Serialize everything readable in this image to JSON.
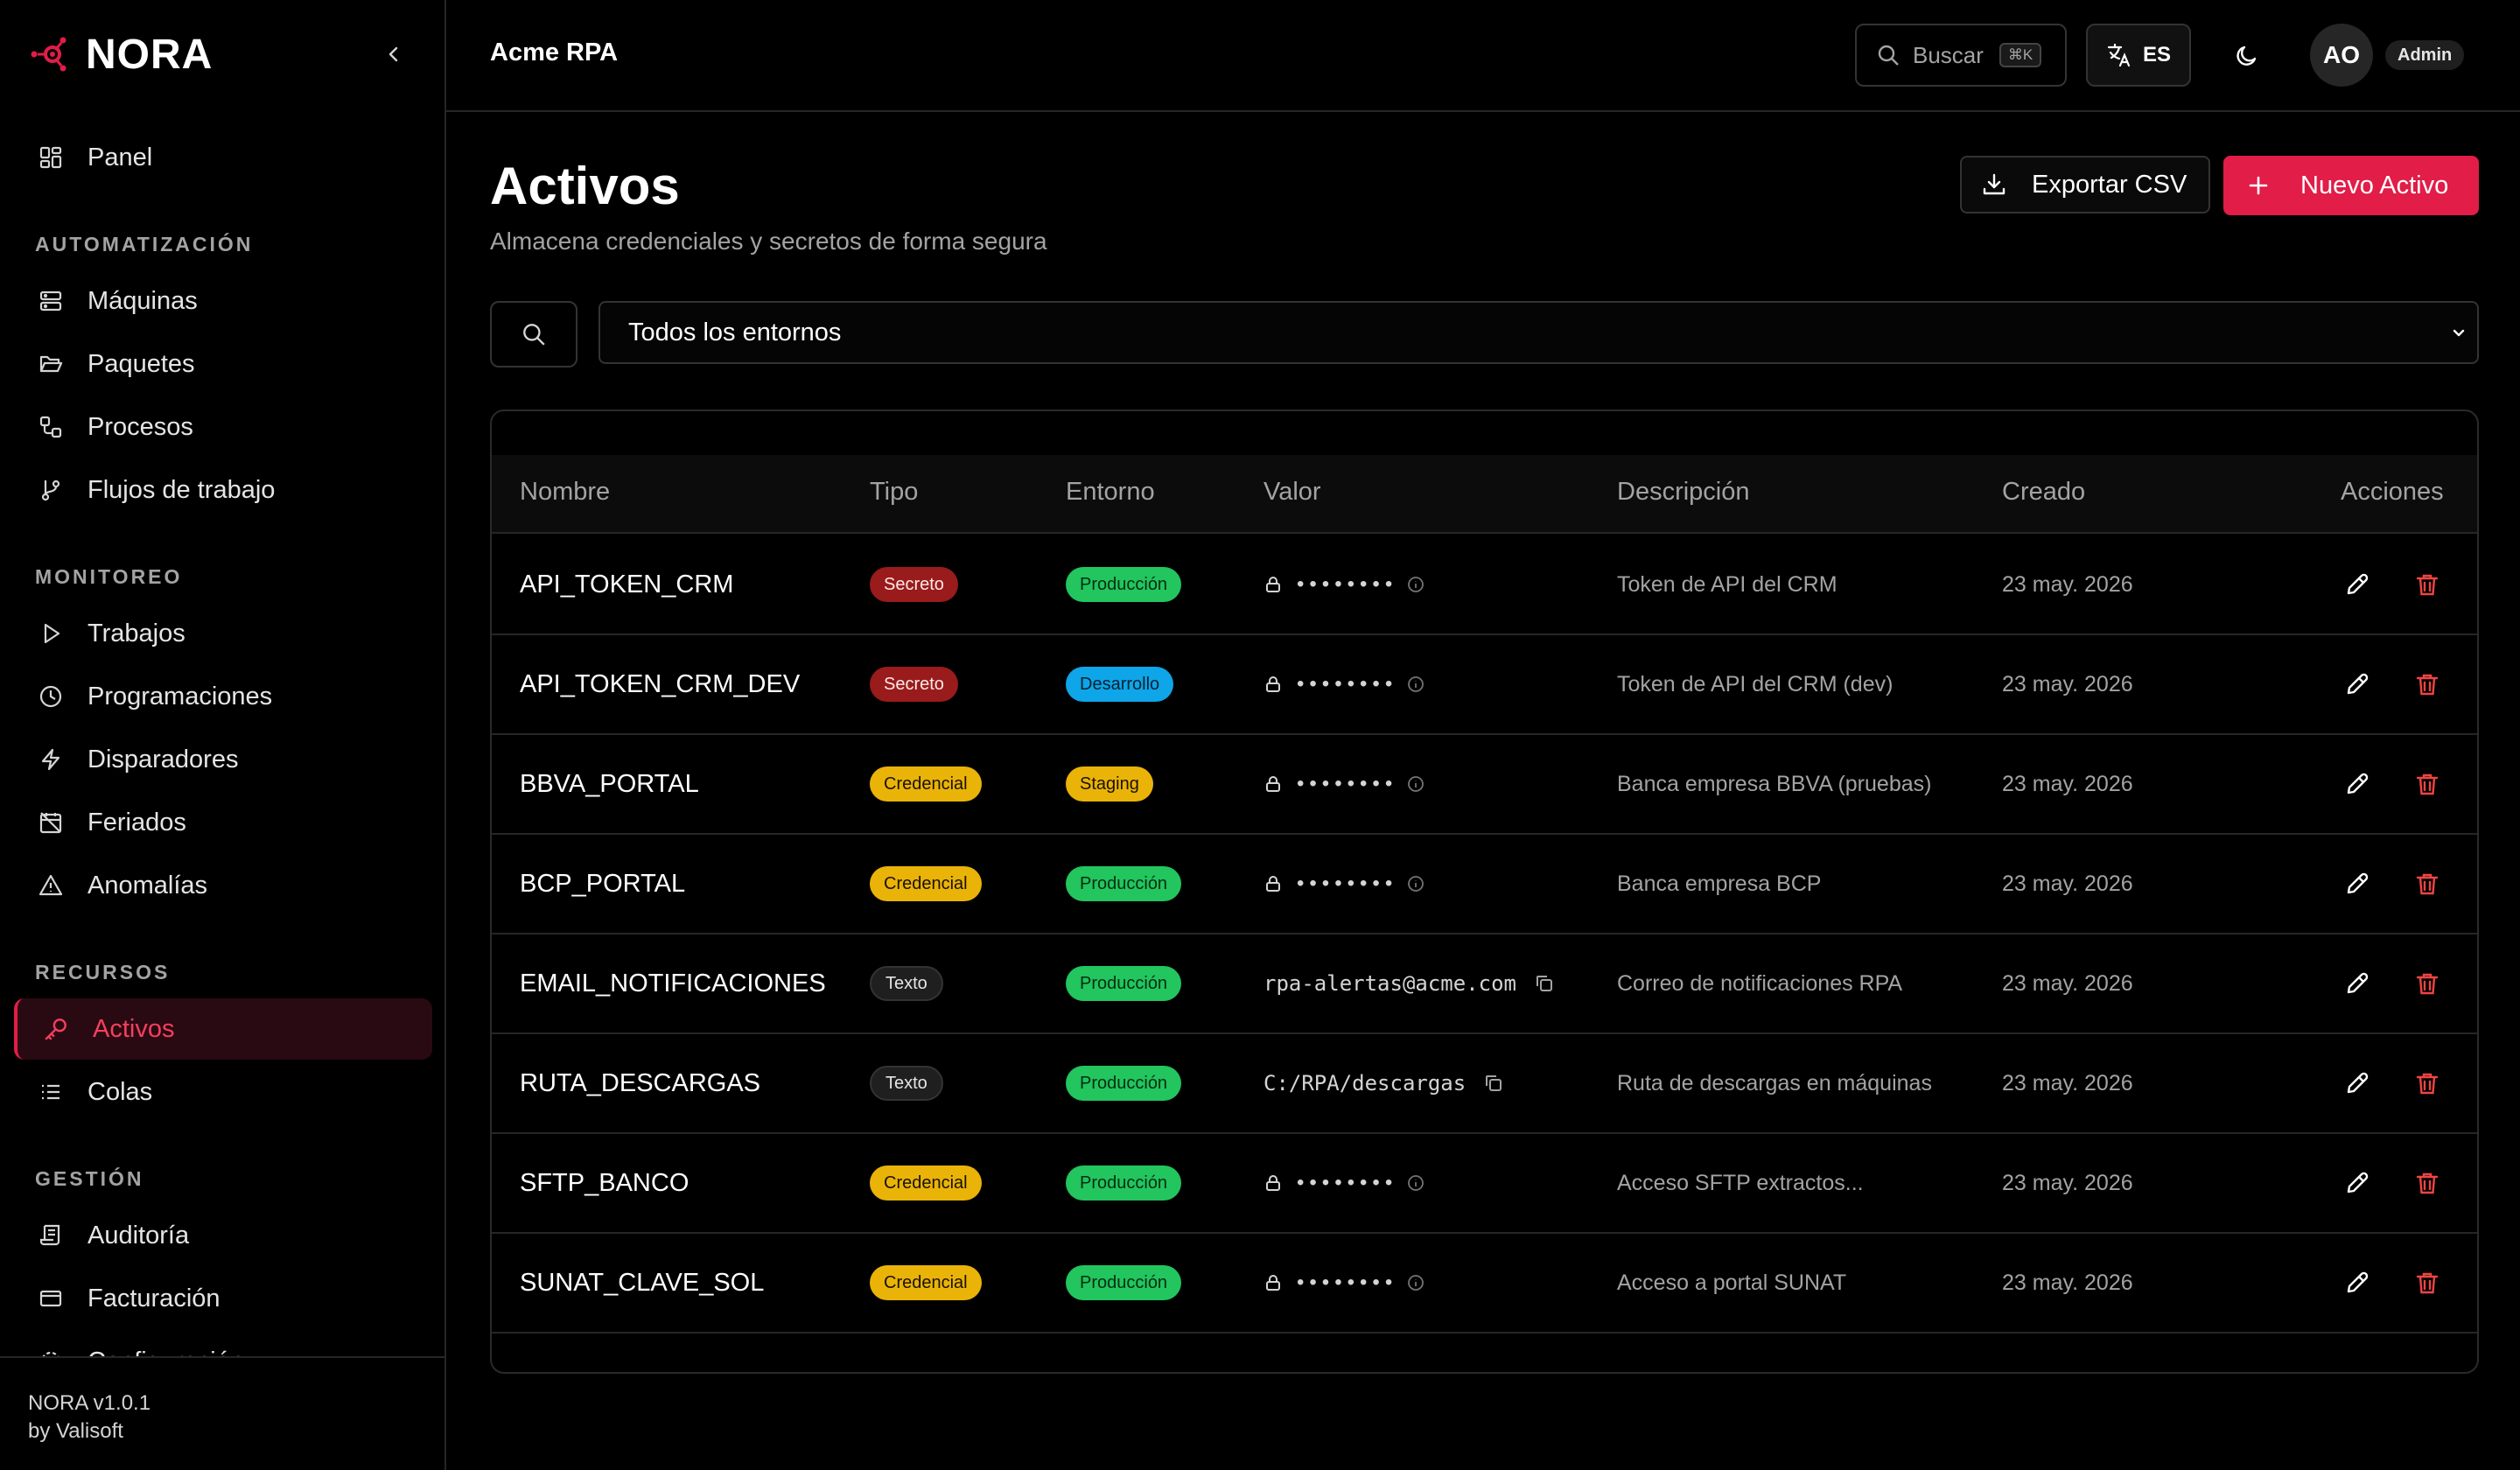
{
  "brand": {
    "name": "NORA"
  },
  "sidebar": {
    "panel": "Panel",
    "sections": {
      "automatizacion": "AUTOMATIZACIÓN",
      "monitoreo": "MONITOREO",
      "recursos": "RECURSOS",
      "gestion": "GESTIÓN"
    },
    "items": {
      "maquinas": "Máquinas",
      "paquetes": "Paquetes",
      "procesos": "Procesos",
      "flujos": "Flujos de trabajo",
      "trabajos": "Trabajos",
      "programaciones": "Programaciones",
      "disparadores": "Disparadores",
      "feriados": "Feriados",
      "anomalias": "Anomalías",
      "activos": "Activos",
      "colas": "Colas",
      "auditoria": "Auditoría",
      "facturacion": "Facturación",
      "configuracion": "Configuración"
    },
    "active": "activos",
    "footer": {
      "version": "NORA v1.0.1",
      "by": "by Valisoft"
    }
  },
  "header": {
    "org": "Acme RPA",
    "search_label": "Buscar",
    "search_kbd": "⌘K",
    "lang": "ES",
    "avatar_initials": "AO",
    "role": "Admin"
  },
  "page": {
    "title": "Activos",
    "subtitle": "Almacena credenciales y secretos de forma segura",
    "export_label": "Exportar CSV",
    "new_label": "Nuevo Activo",
    "env_filter": "Todos los entornos"
  },
  "table": {
    "columns": [
      "Nombre",
      "Tipo",
      "Entorno",
      "Valor",
      "Descripción",
      "Creado",
      "Acciones"
    ],
    "rows": [
      {
        "name": "API_TOKEN_CRM",
        "type": "Secreto",
        "env": "Producción",
        "value": null,
        "desc": "Token de API del CRM",
        "created": "23 may. 2026"
      },
      {
        "name": "API_TOKEN_CRM_DEV",
        "type": "Secreto",
        "env": "Desarrollo",
        "value": null,
        "desc": "Token de API del CRM (dev)",
        "created": "23 may. 2026"
      },
      {
        "name": "BBVA_PORTAL",
        "type": "Credencial",
        "env": "Staging",
        "value": null,
        "desc": "Banca empresa BBVA (pruebas)",
        "created": "23 may. 2026"
      },
      {
        "name": "BCP_PORTAL",
        "type": "Credencial",
        "env": "Producción",
        "value": null,
        "desc": "Banca empresa BCP",
        "created": "23 may. 2026"
      },
      {
        "name": "EMAIL_NOTIFICACIONES",
        "type": "Texto",
        "env": "Producción",
        "value": "rpa-alertas@acme.com",
        "desc": "Correo de notificaciones RPA",
        "created": "23 may. 2026"
      },
      {
        "name": "RUTA_DESCARGAS",
        "type": "Texto",
        "env": "Producción",
        "value": "C:/RPA/descargas",
        "desc": "Ruta de descargas en máquinas",
        "created": "23 may. 2026"
      },
      {
        "name": "SFTP_BANCO",
        "type": "Credencial",
        "env": "Producción",
        "value": null,
        "desc": "Acceso SFTP extractos...",
        "created": "23 may. 2026"
      },
      {
        "name": "SUNAT_CLAVE_SOL",
        "type": "Credencial",
        "env": "Producción",
        "value": null,
        "desc": "Acceso a portal SUNAT",
        "created": "23 may. 2026"
      }
    ],
    "masked_value": "••••••••"
  },
  "colors": {
    "accent": "#e11d48",
    "secreto": "#991b1b",
    "credencial": "#eab308",
    "texto": "#1f1f1f",
    "produccion": "#22c55e",
    "desarrollo": "#0ea5e9",
    "staging": "#eab308"
  }
}
